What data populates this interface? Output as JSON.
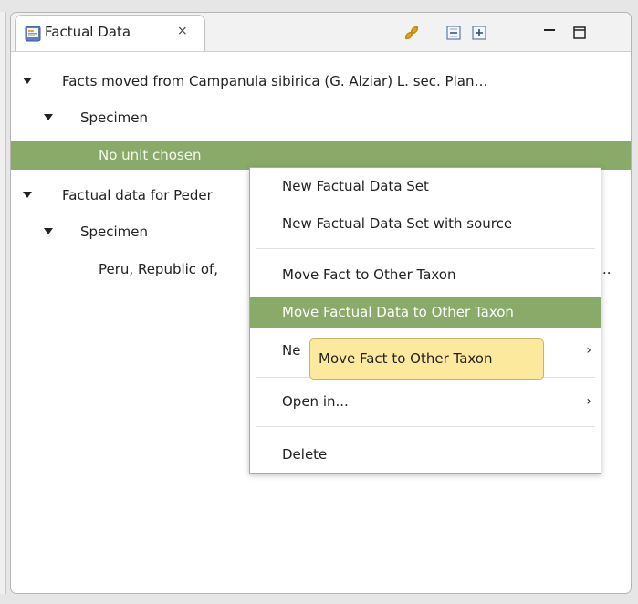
{
  "tab": {
    "title": "Factual Data",
    "close_icon": "⨯",
    "icon_name": "factual-data-icon"
  },
  "toolbar": {
    "link_icon": "link-with-editor-icon",
    "collapse_icon": "collapse-all-icon",
    "expand_icon": "expand-all-icon",
    "minimize_icon": "minimize-icon",
    "maximize_icon": "maximize-icon"
  },
  "tree": {
    "rows": [
      {
        "text": "Facts moved from Campanula sibirica (G. Alziar) L. sec. Plan…",
        "expanded": true
      },
      {
        "text": "Specimen",
        "expanded": true
      },
      {
        "text": "No unit chosen",
        "selected": true
      },
      {
        "text": "Factual data for Peder",
        "expanded": true
      },
      {
        "text": "Specimen",
        "expanded": true
      },
      {
        "text": "Peru, Republic of,",
        "trailing": ".."
      }
    ]
  },
  "context_menu": {
    "items": [
      {
        "label": "New Factual Data Set"
      },
      {
        "label": "New Factual Data Set with source"
      },
      {
        "label": "Move Fact to Other Taxon"
      },
      {
        "label": "Move Factual Data to Other Taxon",
        "highlighted": true
      },
      {
        "label": "Ne",
        "submenu": true
      },
      {
        "label": "Open in...",
        "submenu": true
      },
      {
        "label": "Delete"
      }
    ],
    "submenu_arrow": "›"
  },
  "tooltip": {
    "text": "Move Fact to Other Taxon"
  },
  "colors": {
    "selection": "#8aaa6a",
    "tooltip_bg": "#fde99e"
  }
}
